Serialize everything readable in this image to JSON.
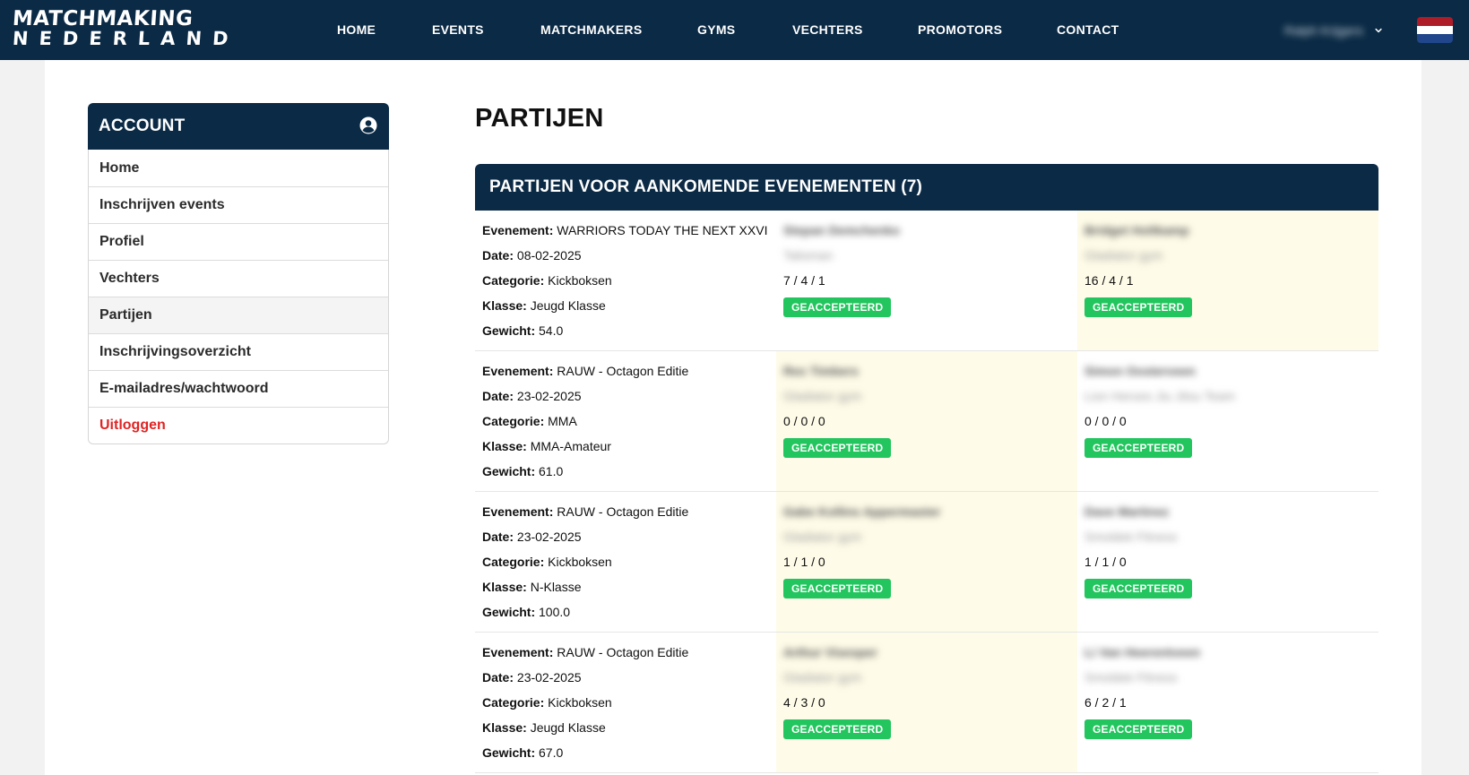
{
  "brand": {
    "line1": "MATCHMAKING",
    "line2": "NEDERLAND"
  },
  "nav": {
    "items": [
      {
        "label": "HOME",
        "name": "nav-home"
      },
      {
        "label": "EVENTS",
        "name": "nav-events"
      },
      {
        "label": "MATCHMAKERS",
        "name": "nav-matchmakers"
      },
      {
        "label": "GYMS",
        "name": "nav-gyms"
      },
      {
        "label": "VECHTERS",
        "name": "nav-vechters"
      },
      {
        "label": "PROMOTORS",
        "name": "nav-promotors"
      },
      {
        "label": "CONTACT",
        "name": "nav-contact"
      }
    ],
    "user_name": "Ralph Krijgers",
    "chevron_icon": "chevron-down-icon",
    "flag_icon": "netherlands-flag-icon"
  },
  "account": {
    "title": "ACCOUNT",
    "icon": "user-circle-icon",
    "items": [
      {
        "label": "Home"
      },
      {
        "label": "Inschrijven events"
      },
      {
        "label": "Profiel"
      },
      {
        "label": "Vechters"
      },
      {
        "label": "Partijen",
        "active": true
      },
      {
        "label": "Inschrijvingsoverzicht"
      },
      {
        "label": "E-mailadres/wachtwoord"
      },
      {
        "label": "Uitloggen",
        "danger": true
      }
    ]
  },
  "page": {
    "title": "PARTIJEN",
    "panel_title": "PARTIJEN VOOR AANKOMENDE EVENEMENTEN (7)",
    "labels": {
      "event": "Evenement:",
      "date": "Date:",
      "category": "Categorie:",
      "class": "Klasse:",
      "weight": "Gewicht:"
    },
    "fights": [
      {
        "event": "WARRIORS TODAY THE NEXT XXVI",
        "date": "08-02-2025",
        "category": "Kickboksen",
        "class": "Jeugd Klasse",
        "weight": "54.0",
        "fighter_a": {
          "name": "Stepan Demchenko",
          "gym": "Talisman",
          "record": "7 / 4 / 1",
          "status": "GEACCEPTEERD",
          "highlight": false
        },
        "fighter_b": {
          "name": "Bridget Holtkamp",
          "gym": "Gladiator gym",
          "record": "16 / 4 / 1",
          "status": "GEACCEPTEERD",
          "highlight": true
        }
      },
      {
        "event": "RAUW - Octagon Editie",
        "date": "23-02-2025",
        "category": "MMA",
        "class": "MMA-Amateur",
        "weight": "61.0",
        "fighter_a": {
          "name": "Rex Timbers",
          "gym": "Gladiator gym",
          "record": "0 / 0 / 0",
          "status": "GEACCEPTEERD",
          "highlight": true
        },
        "fighter_b": {
          "name": "Simon Oosterveen",
          "gym": "Lion Heroes Jiu Jitsu Team",
          "record": "0 / 0 / 0",
          "status": "GEACCEPTEERD",
          "highlight": false
        }
      },
      {
        "event": "RAUW - Octagon Editie",
        "date": "23-02-2025",
        "category": "Kickboksen",
        "class": "N-Klasse",
        "weight": "100.0",
        "fighter_a": {
          "name": "Gabe Kollins Appermaster",
          "gym": "Gladiator gym",
          "record": "1 / 1 / 0",
          "status": "GEACCEPTEERD",
          "highlight": true
        },
        "fighter_b": {
          "name": "Dave Martinez",
          "gym": "Smoldek Fitness",
          "record": "1 / 1 / 0",
          "status": "GEACCEPTEERD",
          "highlight": false
        }
      },
      {
        "event": "RAUW - Octagon Editie",
        "date": "23-02-2025",
        "category": "Kickboksen",
        "class": "Jeugd Klasse",
        "weight": "67.0",
        "fighter_a": {
          "name": "Arthur Visesper",
          "gym": "Gladiator gym",
          "record": "4 / 3 / 0",
          "status": "GEACCEPTEERD",
          "highlight": true
        },
        "fighter_b": {
          "name": "Li Van Heerentveen",
          "gym": "Smoldek Fitness",
          "record": "6 / 2 / 1",
          "status": "GEACCEPTEERD",
          "highlight": false
        }
      }
    ]
  }
}
